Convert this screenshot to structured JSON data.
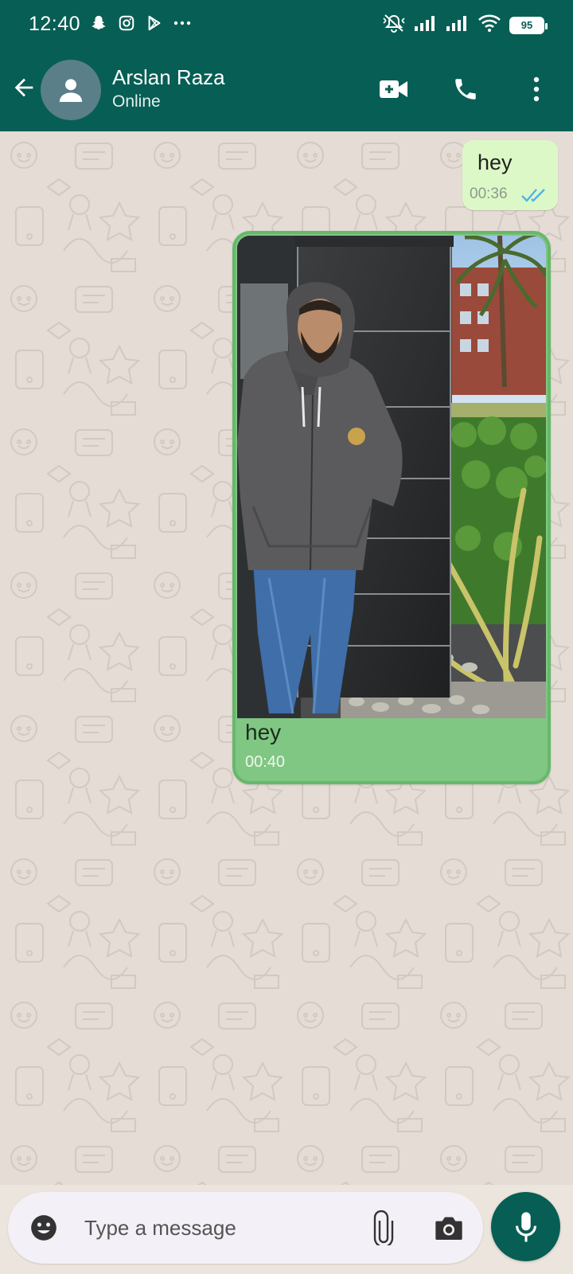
{
  "status_bar": {
    "time": "12:40",
    "battery_level": "95",
    "left_icons": [
      "snapchat-icon",
      "instagram-icon",
      "play-store-icon",
      "more-dots-icon"
    ],
    "right_icons": [
      "mute-icon",
      "signal-icon",
      "signal-icon",
      "wifi-icon",
      "battery-icon"
    ]
  },
  "header": {
    "contact_name": "Arslan Raza",
    "contact_status": "Online",
    "icons": [
      "back-arrow-icon",
      "avatar-icon",
      "video-call-icon",
      "phone-icon",
      "more-vert-icon"
    ]
  },
  "messages": [
    {
      "type": "text",
      "text": "hey",
      "time": "00:36",
      "status": "read"
    },
    {
      "type": "image",
      "caption": "hey",
      "time": "00:40"
    }
  ],
  "composer": {
    "placeholder": "Type a message",
    "value": "",
    "icons": [
      "emoji-icon",
      "attach-icon",
      "camera-icon",
      "mic-icon"
    ]
  },
  "colors": {
    "header": "#075e54",
    "chat_background": "#e4dcd5",
    "text_bubble": "#dcf8c6",
    "image_bubble": "#80c783",
    "read_ticks": "#4fb3e8"
  }
}
